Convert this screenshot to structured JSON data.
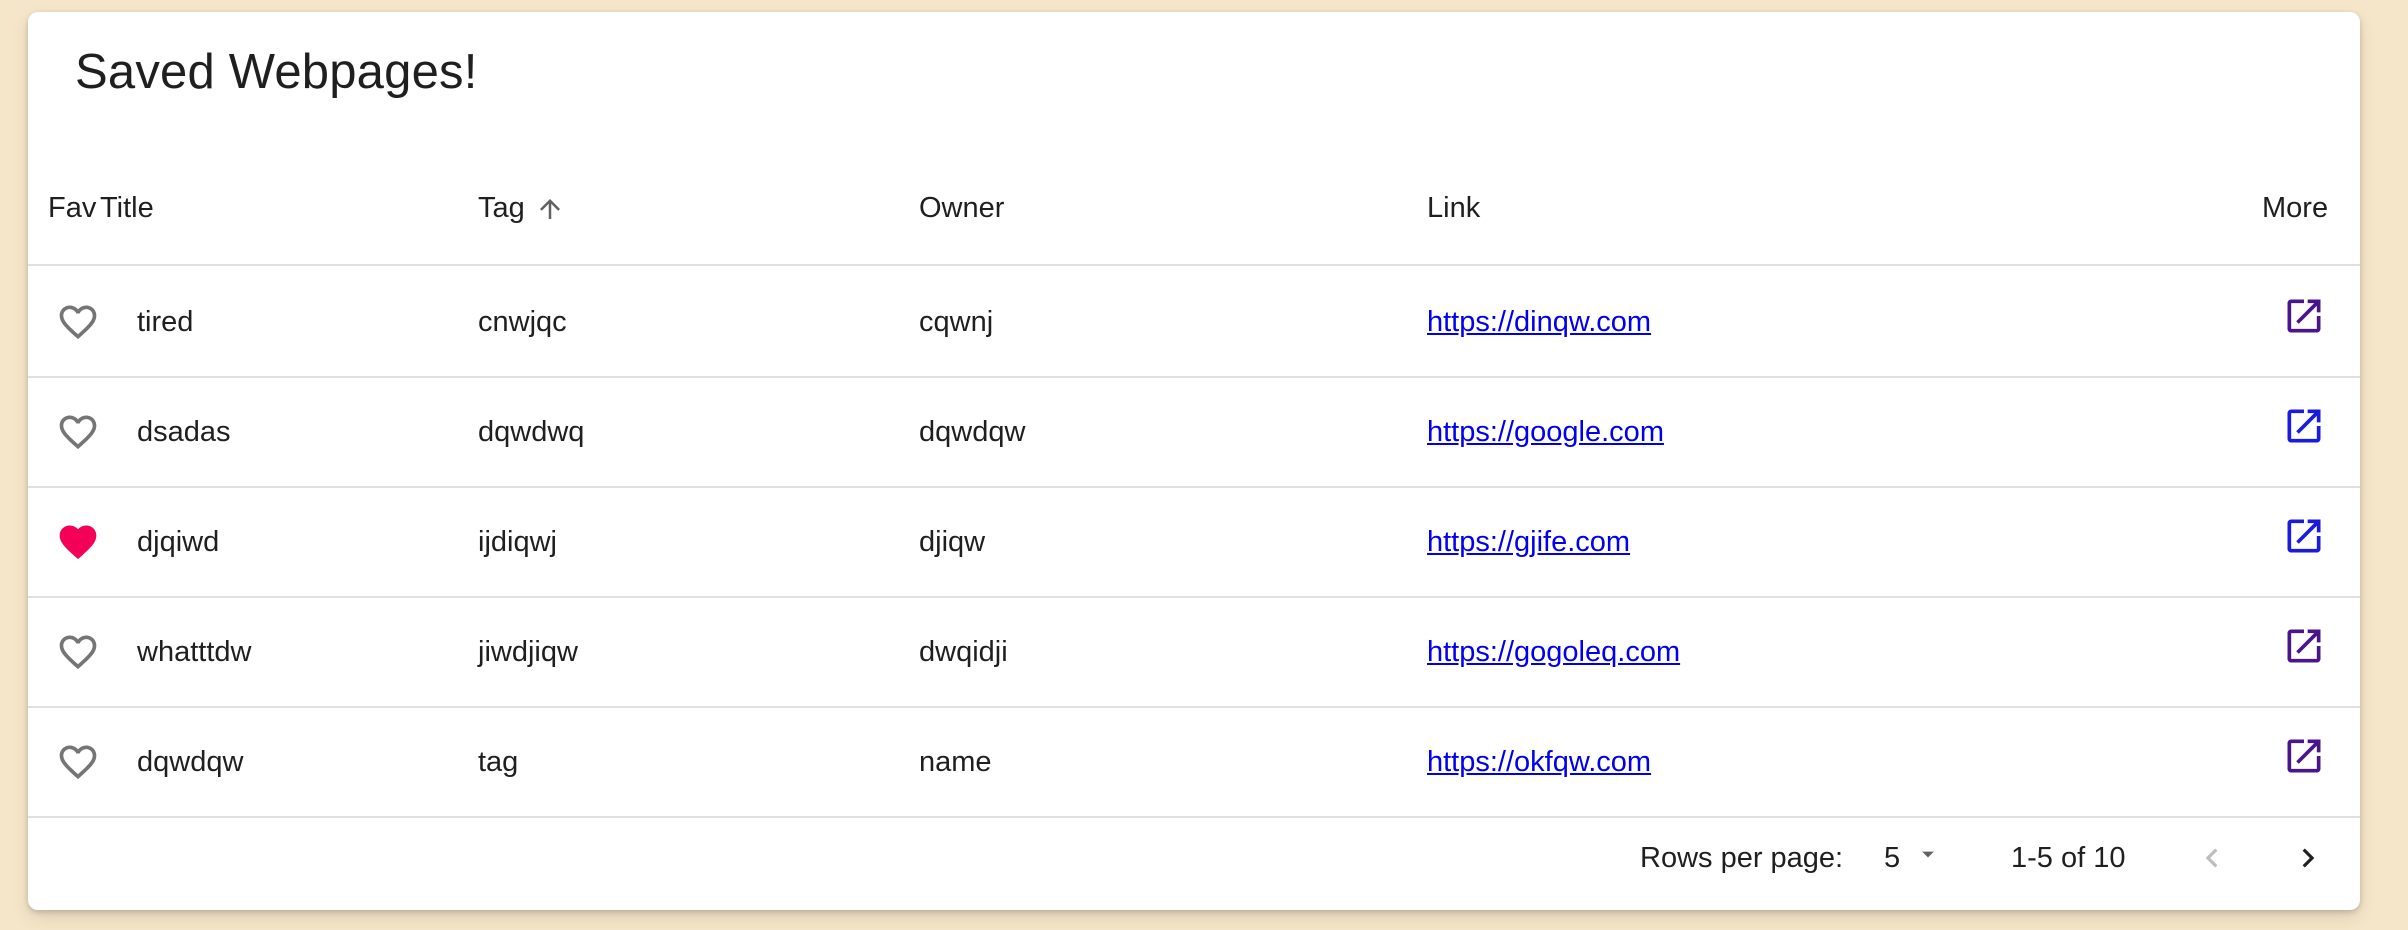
{
  "page": {
    "title": "Saved Webpages!"
  },
  "table": {
    "headers": {
      "fav": "Fav",
      "title": "Title",
      "tag": "Tag",
      "owner": "Owner",
      "link": "Link",
      "more": "More"
    },
    "sort": {
      "column": "Tag",
      "direction": "ascending",
      "icon": "arrow-up-icon"
    },
    "rows": [
      {
        "favorite": false,
        "title": "tired",
        "tag": "cnwjqc",
        "owner": "cqwnj",
        "link": "https://dinqw.com",
        "more_icon": "open-in-new-icon",
        "more_color": "#4a148c"
      },
      {
        "favorite": false,
        "title": "dsadas",
        "tag": "dqwdwq",
        "owner": "dqwdqw",
        "link": "https://google.com",
        "more_icon": "open-in-new-icon",
        "more_color": "#1a1ae0"
      },
      {
        "favorite": true,
        "title": "djqiwd",
        "tag": "ijdiqwj",
        "owner": "djiqw",
        "link": "https://gjife.com",
        "more_icon": "open-in-new-icon",
        "more_color": "#1a1ae0"
      },
      {
        "favorite": false,
        "title": "whatttdw",
        "tag": "jiwdjiqw",
        "owner": "dwqidji",
        "link": "https://gogoleq.com",
        "more_icon": "open-in-new-icon",
        "more_color": "#4a148c"
      },
      {
        "favorite": false,
        "title": "dqwdqw",
        "tag": "tag",
        "owner": "name",
        "link": "https://okfqw.com",
        "more_icon": "open-in-new-icon",
        "more_color": "#4a148c"
      }
    ]
  },
  "pagination": {
    "rows_per_page_label": "Rows per page:",
    "rows_per_page_value": "5",
    "range_label": "1-5 of 10",
    "prev_icon": "chevron-left-icon",
    "next_icon": "chevron-right-icon"
  },
  "colors": {
    "background": "#f6e6c9",
    "favorite_active": "#f50057",
    "favorite_inactive": "#757575",
    "link": "#0000ee"
  }
}
